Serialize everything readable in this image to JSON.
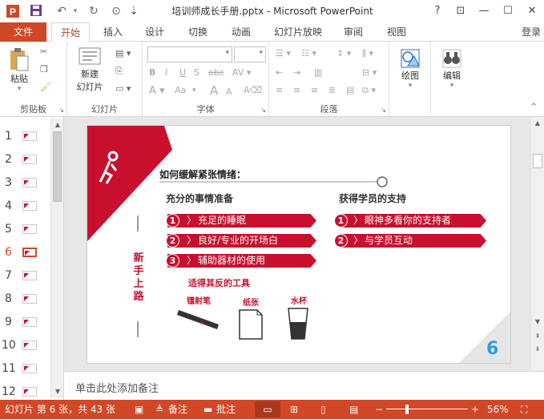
{
  "window": {
    "title": "培训师成长手册.pptx - Microsoft PowerPoint",
    "help": "?",
    "restore": "⊡",
    "minimize": "—",
    "maximize": "☐",
    "close": "✕",
    "quick_access": {
      "save": "💾",
      "undo": "↶",
      "redo": "↻",
      "present": "⊙",
      "more": "⇣"
    }
  },
  "tabs": {
    "file": "文件",
    "items": [
      "开始",
      "插入",
      "设计",
      "切换",
      "动画",
      "幻灯片放映",
      "审阅",
      "视图"
    ],
    "signin": "登录"
  },
  "ribbon": {
    "clipboard": {
      "label": "剪贴板",
      "paste": "粘贴"
    },
    "slides": {
      "label": "幻灯片",
      "new_slide_l1": "新建",
      "new_slide_l2": "幻灯片"
    },
    "font": {
      "label": "字体",
      "bold": "B",
      "italic": "I",
      "underline": "U",
      "strike": "S",
      "abc": "abc",
      "aa": "Aa",
      "grow": "A",
      "shrink": "A"
    },
    "paragraph": {
      "label": "段落"
    },
    "drawing": {
      "label": "绘图"
    },
    "editing": {
      "label": "编辑"
    }
  },
  "thumbnails": {
    "numbers": [
      "1",
      "2",
      "3",
      "4",
      "5",
      "6",
      "7",
      "8",
      "9",
      "10",
      "11",
      "12"
    ],
    "selected": "6"
  },
  "slide": {
    "heading": "如何缓解紧张情绪：",
    "side_title": [
      "新",
      "手",
      "上",
      "路"
    ],
    "left_col_title": "充分的事情准备",
    "left_items": [
      {
        "num": "1",
        "text": "充足的睡眠"
      },
      {
        "num": "2",
        "text": "良好/专业的开场白"
      },
      {
        "num": "3",
        "text": "辅助器材的使用"
      }
    ],
    "tools_title": "适得其反的工具",
    "tools": [
      "镭射笔",
      "纸张",
      "水杯"
    ],
    "right_col_title": "获得学员的支持",
    "right_items": [
      {
        "num": "1",
        "text": "眼神多看你的支持者"
      },
      {
        "num": "2",
        "text": "与学员互动"
      }
    ],
    "page_number": "6"
  },
  "notes": {
    "placeholder": "单击此处添加备注"
  },
  "status": {
    "slide_info": "幻灯片 第 6 张，共 43 张",
    "notes_btn": "备注",
    "comments_btn": "批注",
    "zoom": "56%",
    "minus": "−",
    "plus": "+"
  },
  "colors": {
    "accent": "#d24726",
    "slide_red": "#c8102e",
    "page_num": "#2b9fe0"
  }
}
